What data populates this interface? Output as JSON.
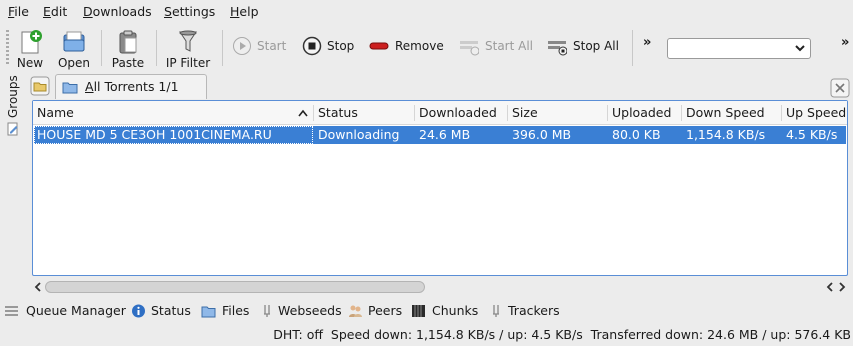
{
  "menubar": {
    "items": [
      "File",
      "Edit",
      "Downloads",
      "Settings",
      "Help"
    ],
    "mnemonics": [
      "F",
      "E",
      "D",
      "S",
      "H"
    ]
  },
  "toolbar": {
    "new_label": "New",
    "open_label": "Open",
    "paste_label": "Paste",
    "ipfilter_label": "IP Filter",
    "start_label": "Start",
    "stop_label": "Stop",
    "remove_label": "Remove",
    "startall_label": "Start All",
    "stopall_label": "Stop All",
    "overflow_glyph": "»",
    "combo_value": "",
    "start_enabled": false,
    "startall_enabled": false
  },
  "groups": {
    "sidebar_label": "Groups"
  },
  "tabs": [
    {
      "label": "All Torrents 1/1",
      "mnemonic": "A"
    }
  ],
  "table": {
    "columns": [
      "Name",
      "Status",
      "Downloaded",
      "Size",
      "Uploaded",
      "Down Speed",
      "Up Speed"
    ],
    "sort_column": "Name",
    "rows": [
      {
        "name": "HOUSE MD 5 СЕЗОН 1001CINEMA.RU",
        "status": "Downloading",
        "downloaded": "24.6 MB",
        "size": "396.0 MB",
        "uploaded": "80.0 KB",
        "down_speed": "1,154.8 KB/s",
        "up_speed": "4.5 KB/s",
        "selected": true
      }
    ]
  },
  "bottom_tabs": [
    "Queue Manager",
    "Status",
    "Files",
    "Webseeds",
    "Peers",
    "Chunks",
    "Trackers"
  ],
  "statusbar": {
    "text": "DHT: off  Speed down: 1,154.8 KB/s / up: 4.5 KB/s  Transferred down: 24.6 MB / up: 576.4 KB"
  },
  "colors": {
    "selection": "#3a7fd4",
    "table_border": "#5a8ed6",
    "stop_icon_red": "#cc1f1f"
  }
}
